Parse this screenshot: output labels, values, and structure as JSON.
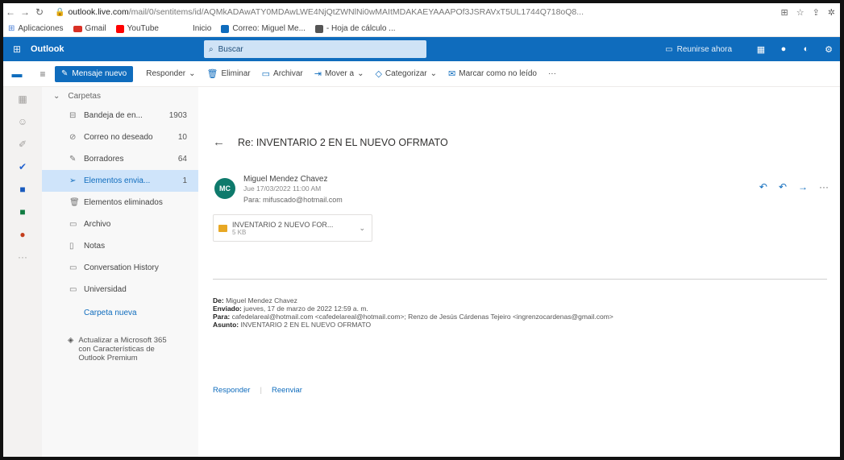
{
  "browser": {
    "url_domain": "outlook.live.com",
    "url_path": "/mail/0/sentitems/id/AQMkADAwATY0MDAwLWE4NjQtZWNlNi0wMAItMDAKAEYAAAPOf3JSRAVxT5UL1744Q718oQ8...",
    "bookmarks": [
      "Aplicaciones",
      "Gmail",
      "YouTube",
      "Inicio",
      "Correo: Miguel Me...",
      "- Hoja de cálculo ..."
    ]
  },
  "outlook": {
    "app_name": "Outlook",
    "search_placeholder": "Buscar",
    "meet_now": "Reunirse ahora"
  },
  "ribbon": {
    "new_message": "Mensaje nuevo",
    "reply": "Responder",
    "delete": "Eliminar",
    "archive": "Archivar",
    "move": "Mover a",
    "categorize": "Categorizar",
    "mark_unread": "Marcar como no leído"
  },
  "folders": {
    "header": "Carpetas",
    "items": [
      {
        "label": "Bandeja de en...",
        "count": "1903"
      },
      {
        "label": "Correo no deseado",
        "count": "10"
      },
      {
        "label": "Borradores",
        "count": "64"
      },
      {
        "label": "Elementos envia...",
        "count": "1"
      },
      {
        "label": "Elementos eliminados",
        "count": ""
      },
      {
        "label": "Archivo",
        "count": ""
      },
      {
        "label": "Notas",
        "count": ""
      },
      {
        "label": "Conversation History",
        "count": ""
      },
      {
        "label": "Universidad",
        "count": ""
      }
    ],
    "new_folder": "Carpeta nueva",
    "upgrade_lines": [
      "Actualizar a Microsoft 365",
      "con Características de",
      "Outlook Premium"
    ]
  },
  "message": {
    "subject": "Re: INVENTARIO 2 EN EL NUEVO OFRMATO",
    "avatar_initials": "MC",
    "sender_name": "Miguel Mendez Chavez",
    "sent_date": "Jue 17/03/2022 11:00 AM",
    "to_label": "Para:",
    "to_value": "mifuscado@hotmail.com",
    "attachment_name": "INVENTARIO 2 NUEVO FOR...",
    "attachment_size": "5 KB",
    "quoted": {
      "de_label": "De:",
      "de_value": "Miguel Mendez Chavez",
      "enviado_label": "Enviado:",
      "enviado_value": "jueves, 17 de marzo de 2022 12:59 a. m.",
      "para_label": "Para:",
      "para_value": "cafedelareal@hotmail.com <cafedelareal@hotmail.com>; Renzo de Jesús Cárdenas Tejeiro <ingrenzocardenas@gmail.com>",
      "asunto_label": "Asunto:",
      "asunto_value": "INVENTARIO 2 EN EL NUEVO OFRMATO"
    },
    "reply_link": "Responder",
    "forward_link": "Reenviar"
  }
}
